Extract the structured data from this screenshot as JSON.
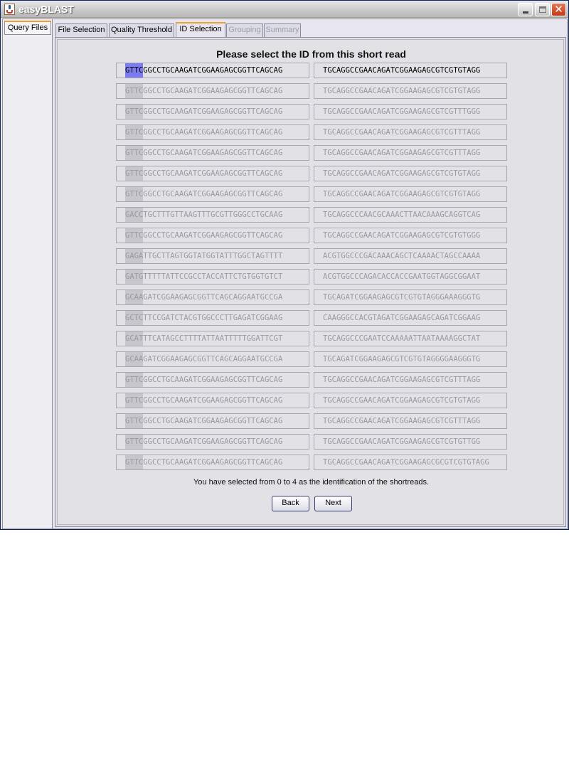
{
  "window": {
    "title": "easyBLAST"
  },
  "left_tab": {
    "label": "Query Files"
  },
  "tabs": [
    {
      "label": "File Selection",
      "state": "normal"
    },
    {
      "label": "Quality Threshold",
      "state": "normal"
    },
    {
      "label": "ID Selection",
      "state": "active"
    },
    {
      "label": "Grouping",
      "state": "disabled"
    },
    {
      "label": "Summary",
      "state": "disabled"
    }
  ],
  "heading": "Please select the ID from this short read",
  "reads": [
    {
      "id": "GTTC",
      "left_rest": "GGCCTGCAAGATCGGAAGAGCGGTTCAGCAG",
      "right": "TGCAGGCCGAACAGATCGGAAGAGCGTCGTGTAGG"
    },
    {
      "id": "GTTC",
      "left_rest": "GGCCTGCAAGATCGGAAGAGCGGTTCAGCAG",
      "right": "TGCAGGCCGAACAGATCGGAAGAGCGTCGTGTAGG"
    },
    {
      "id": "GTTC",
      "left_rest": "GGCCTGCAAGATCGGAAGAGCGGTTCAGCAG",
      "right": "TGCAGGCCGAACAGATCGGAAGAGCGTCGTTTGGG"
    },
    {
      "id": "GTTC",
      "left_rest": "GGCCTGCAAGATCGGAAGAGCGGTTCAGCAG",
      "right": "TGCAGGCCGAACAGATCGGAAGAGCGTCGTTTAGG"
    },
    {
      "id": "GTTC",
      "left_rest": "GGCCTGCAAGATCGGAAGAGCGGTTCAGCAG",
      "right": "TGCAGGCCGAACAGATCGGAAGAGCGTCGTTTAGG"
    },
    {
      "id": "GTTC",
      "left_rest": "GGCCTGCAAGATCGGAAGAGCGGTTCAGCAG",
      "right": "TGCAGGCCGAACAGATCGGAAGAGCGTCGTGTAGG"
    },
    {
      "id": "GTTC",
      "left_rest": "GGCCTGCAAGATCGGAAGAGCGGTTCAGCAG",
      "right": "TGCAGGCCGAACAGATCGGAAGAGCGTCGTGTAGG"
    },
    {
      "id": "GACC",
      "left_rest": "TGCTTTGTTAAGTTTGCGTTGGGCCTGCAAG",
      "right": "TGCAGGCCCAACGCAAACTTAACAAAGCAGGTCAG"
    },
    {
      "id": "GTTC",
      "left_rest": "GGCCTGCAAGATCGGAAGAGCGGTTCAGCAG",
      "right": "TGCAGGCCGAACAGATCGGAAGAGCGTCGTGTGGG"
    },
    {
      "id": "GAGA",
      "left_rest": "TTGCTTAGTGGTATGGTATTTGGCTAGTTTT",
      "right": "ACGTGGCCCGACAAACAGCTCAAAACTAGCCAAAA"
    },
    {
      "id": "GATG",
      "left_rest": "TTTTTATTCCGCCTACCATTCTGTGGTGTCT",
      "right": "ACGTGGCCCAGACACCACCGAATGGTAGGCGGAAT"
    },
    {
      "id": "GCAA",
      "left_rest": "GATCGGAAGAGCGGTTCAGCAGGAATGCCGA",
      "right": "TGCAGATCGGAAGAGCGTCGTGTAGGGAAAGGGTG"
    },
    {
      "id": "GCTC",
      "left_rest": "TTCCGATCTACGTGGCCCTTGAGATCGGAAG",
      "right": "CAAGGGCCACGTAGATCGGAAGAGCAGATCGGAAG"
    },
    {
      "id": "GCAT",
      "left_rest": "TTCATAGCCTTTTATTAATTTTTGGATTCGT",
      "right": "TGCAGGCCCGAATCCAAAAATTAATAAAAGGCTAT"
    },
    {
      "id": "GCAA",
      "left_rest": "GATCGGAAGAGCGGTTCAGCAGGAATGCCGA",
      "right": "TGCAGATCGGAAGAGCGTCGTGTAGGGGAAGGGTG"
    },
    {
      "id": "GTTC",
      "left_rest": "GGCCTGCAAGATCGGAAGAGCGGTTCAGCAG",
      "right": "TGCAGGCCGAACAGATCGGAAGAGCGTCGTTTAGG"
    },
    {
      "id": "GTTC",
      "left_rest": "GGCCTGCAAGATCGGAAGAGCGGTTCAGCAG",
      "right": "TGCAGGCCGAACAGATCGGAAGAGCGTCGTGTAGG"
    },
    {
      "id": "GTTC",
      "left_rest": "GGCCTGCAAGATCGGAAGAGCGGTTCAGCAG",
      "right": "TGCAGGCCGAACAGATCGGAAGAGCGTCGTTTAGG"
    },
    {
      "id": "GTTC",
      "left_rest": "GGCCTGCAAGATCGGAAGAGCGGTTCAGCAG",
      "right": "TGCAGGCCGAACAGATCGGAAGAGCGTCGTGTTGG"
    },
    {
      "id": "GTTC",
      "left_rest": "GGCCTGCAAGATCGGAAGAGCGGTTCAGCAG",
      "right": "TGCAGGCCGAACAGATCGGAAGAGCGCGTCGTGTAGG"
    }
  ],
  "info_text": "You have selected from 0 to 4 as the identification of the shortreads.",
  "buttons": {
    "back": "Back",
    "next": "Next"
  },
  "colors": {
    "id_highlight": "#7c7cf0",
    "tab_accent": "#f0a030"
  }
}
